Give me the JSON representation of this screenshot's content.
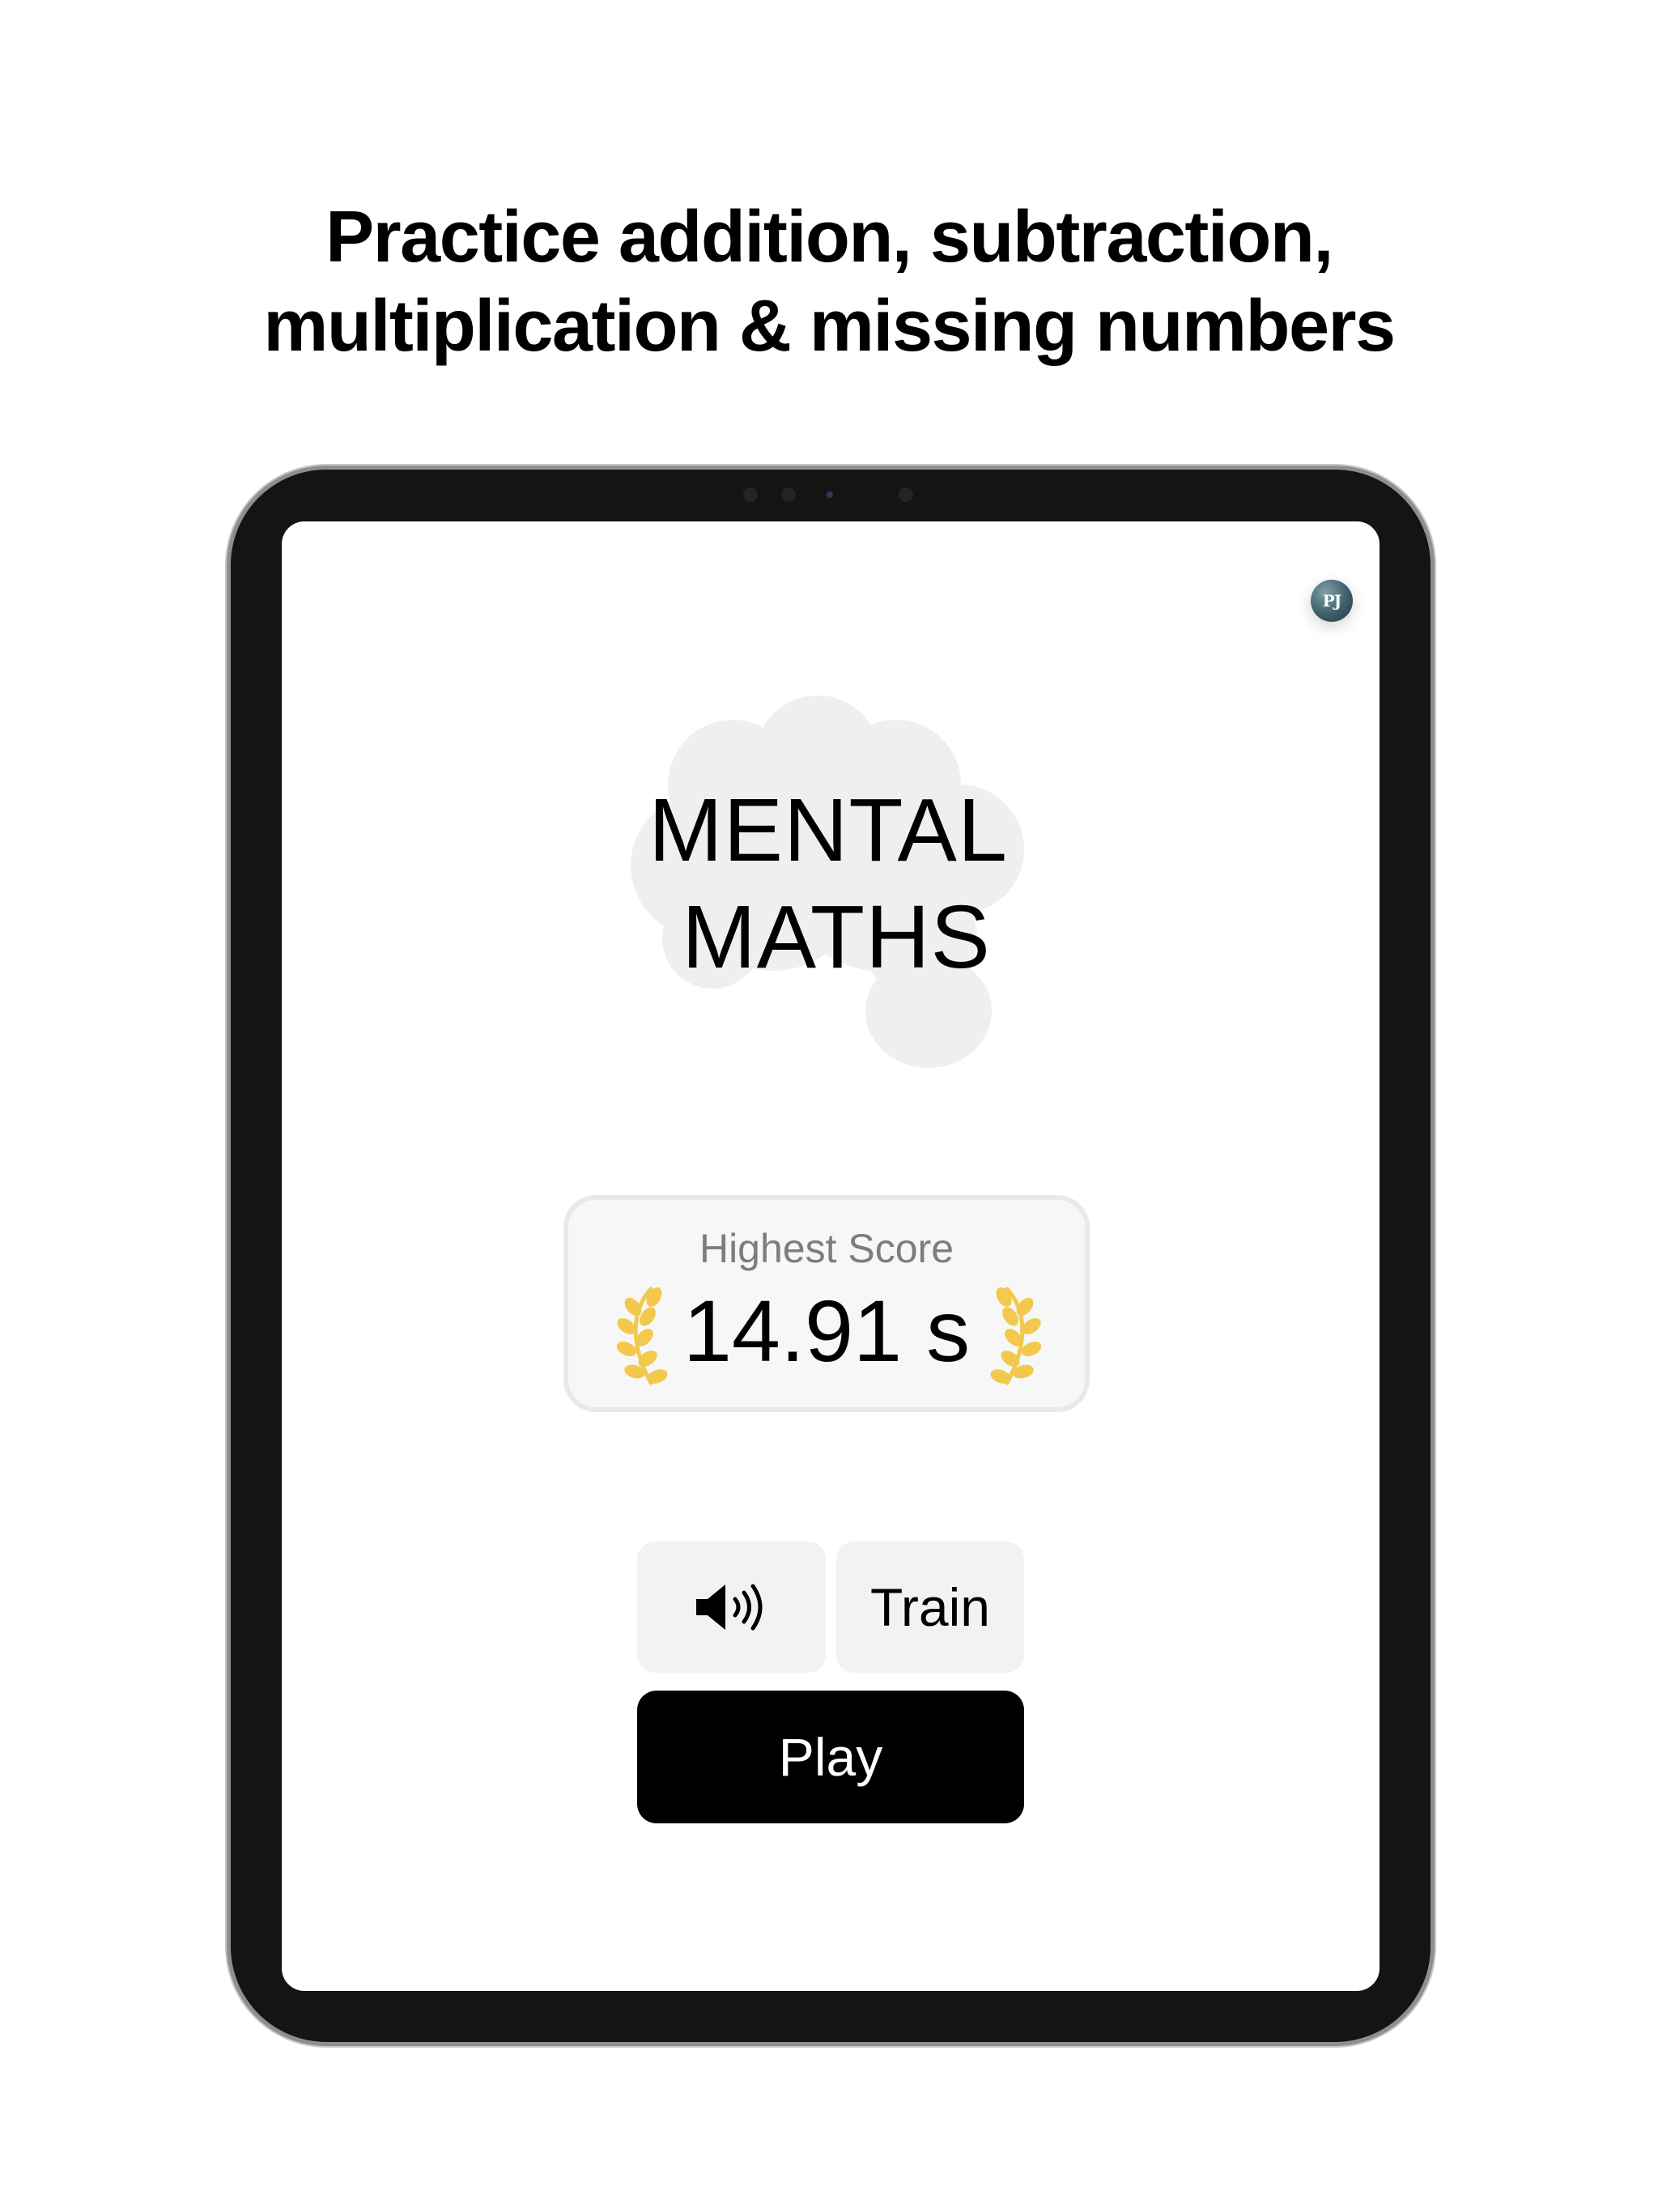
{
  "headline": {
    "line1": "Practice addition, subtraction,",
    "line2": "multiplication & missing numbers"
  },
  "app": {
    "title_line1": "MENTAL",
    "title_line2": "MATHS",
    "avatar_initials": "PJ"
  },
  "score": {
    "label": "Highest Score",
    "value": "14.91 s"
  },
  "buttons": {
    "sound_icon": "speaker-wave-icon",
    "train_label": "Train",
    "play_label": "Play"
  },
  "colors": {
    "accent": "#000000",
    "laurel": "#f2c94c",
    "card_background": "#f7f7f7",
    "button_background": "#f2f2f2"
  }
}
